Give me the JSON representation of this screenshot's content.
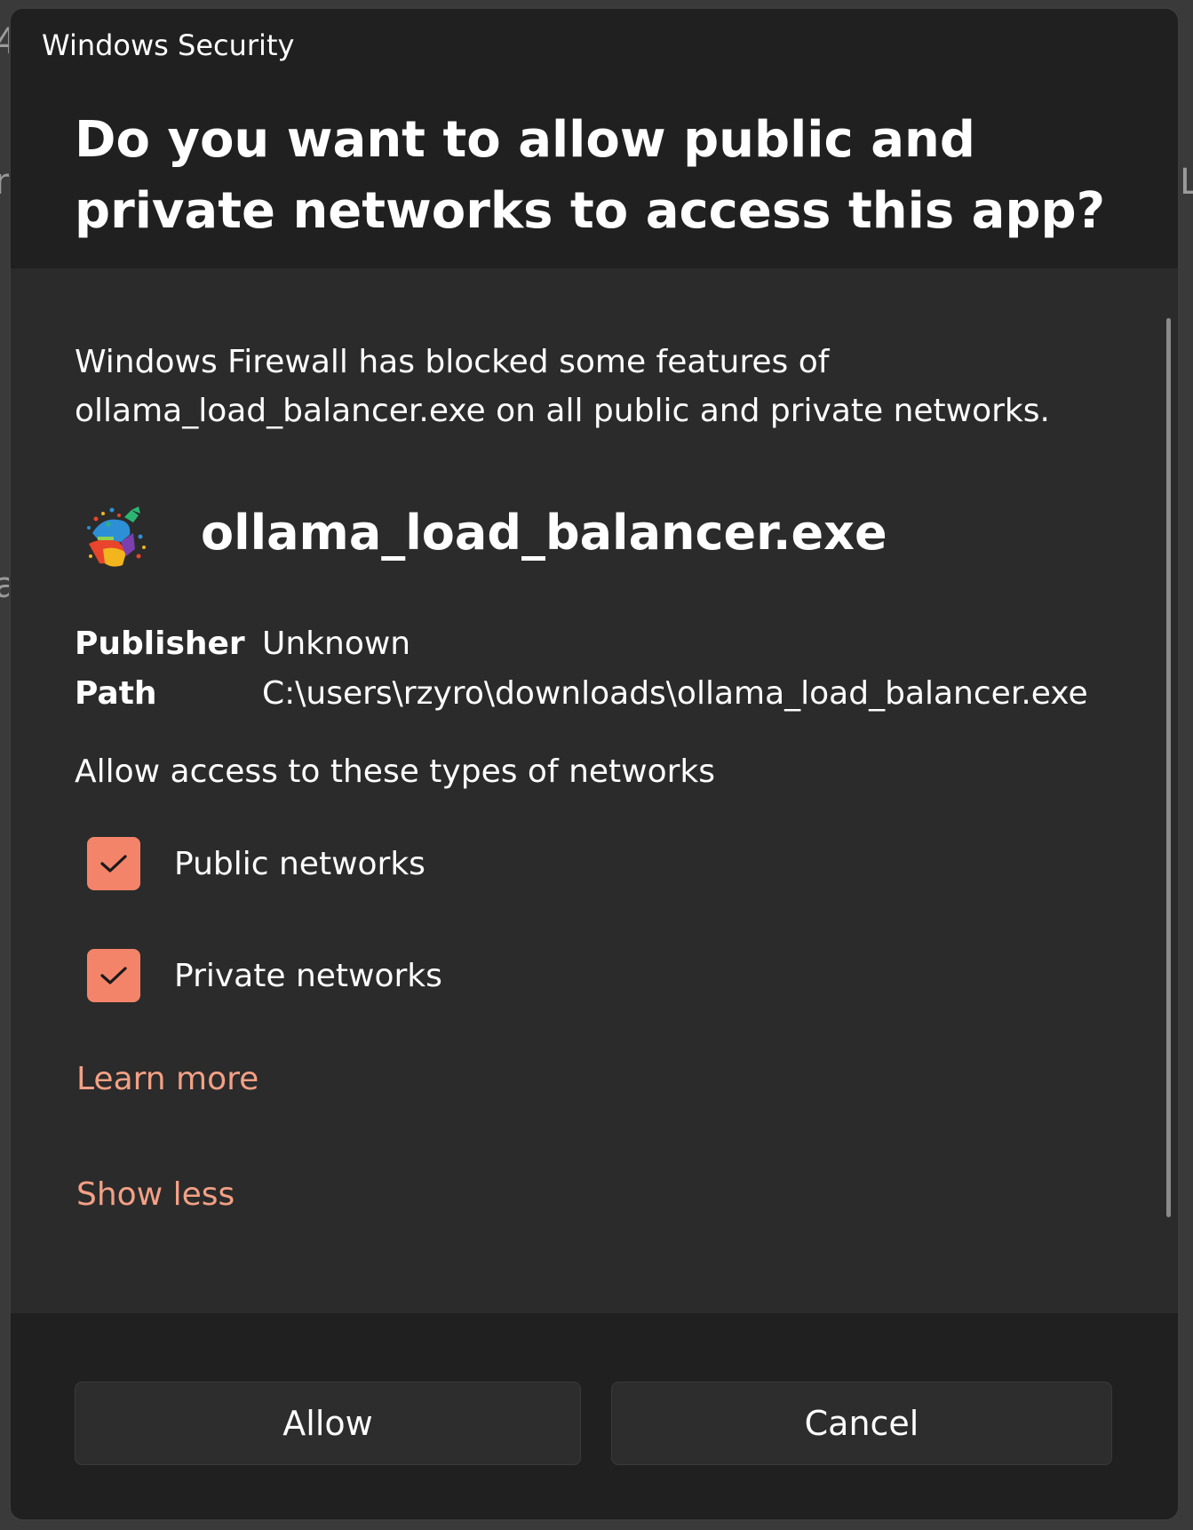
{
  "window": {
    "title": "Windows Security"
  },
  "header": {
    "question": "Do you want to allow public and private networks to access this app?"
  },
  "body": {
    "description": "Windows Firewall has blocked some features of ollama_load_balancer.exe on all public and private networks.",
    "app": {
      "name": "ollama_load_balancer.exe",
      "icon": "ollama-app-icon"
    },
    "info": [
      {
        "label": "Publisher",
        "value": "Unknown"
      },
      {
        "label": "Path",
        "value": "C:\\users\\rzyro\\downloads\\ollama_load_balancer.exe"
      }
    ],
    "networks_heading": "Allow access to these types of networks",
    "networks": [
      {
        "label": "Public networks",
        "checked": true
      },
      {
        "label": "Private networks",
        "checked": true
      }
    ],
    "learn_more": "Learn more",
    "show_less": "Show less"
  },
  "footer": {
    "allow_label": "Allow",
    "cancel_label": "Cancel"
  },
  "colors": {
    "accent": "#f3846a",
    "link": "#f3a085",
    "dialog_bg": "#202020",
    "content_bg": "#2b2b2b"
  }
}
